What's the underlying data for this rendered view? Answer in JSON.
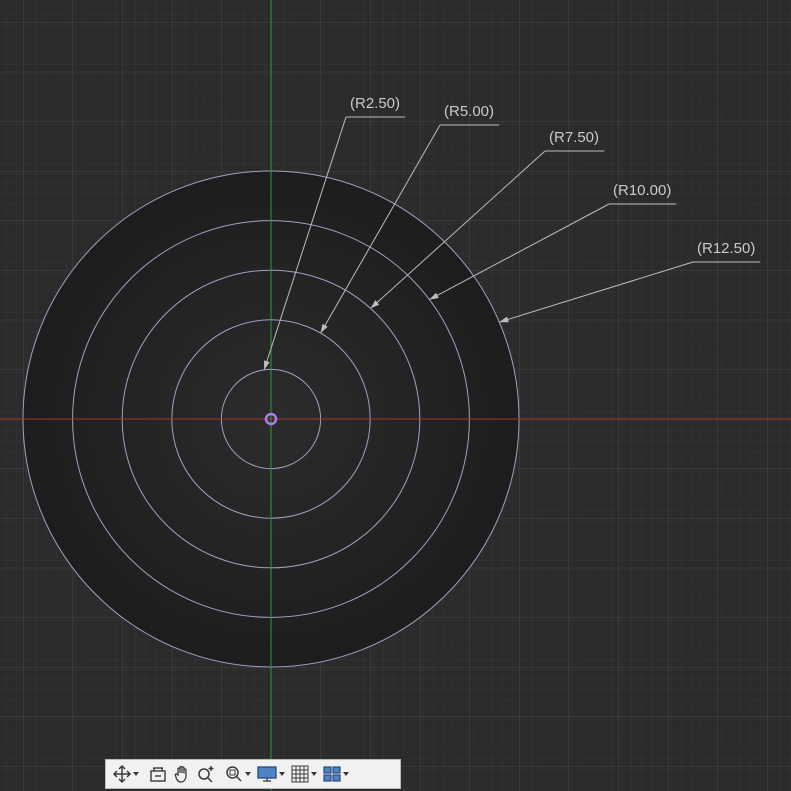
{
  "sketch": {
    "background_color": "#2b2b2b",
    "grid_minor_color": "#363636",
    "grid_major_color": "#474747",
    "x_axis_color": "#b03030",
    "y_axis_color": "#2f9a3a",
    "circle_fill_color": "#1f1f1f",
    "circle_stroke_color": "#b9b5de",
    "center_point_color": "#a97cf0",
    "leader_color": "#bdbdbd",
    "radius_unit_px_per_unit": 19.84,
    "circles": [
      {
        "radius": 2.5,
        "label": "(R2.50)"
      },
      {
        "radius": 5.0,
        "label": "(R5.00)"
      },
      {
        "radius": 7.5,
        "label": "(R7.50)"
      },
      {
        "radius": 10.0,
        "label": "(R10.00)"
      },
      {
        "radius": 12.5,
        "label": "(R12.50)"
      }
    ]
  },
  "toolbar": {
    "background_color": "#f1f1f1",
    "tools": [
      {
        "name": "orbit-icon",
        "has_dropdown": true
      },
      {
        "name": "look-at-icon",
        "has_dropdown": false
      },
      {
        "name": "pan-hand-icon",
        "has_dropdown": false
      },
      {
        "name": "zoom-icon",
        "has_dropdown": false
      },
      {
        "name": "fit-zoom-icon",
        "has_dropdown": true
      },
      {
        "name": "display-settings-icon",
        "has_dropdown": true
      },
      {
        "name": "grid-snap-icon",
        "has_dropdown": true
      },
      {
        "name": "viewports-icon",
        "has_dropdown": true
      }
    ]
  }
}
